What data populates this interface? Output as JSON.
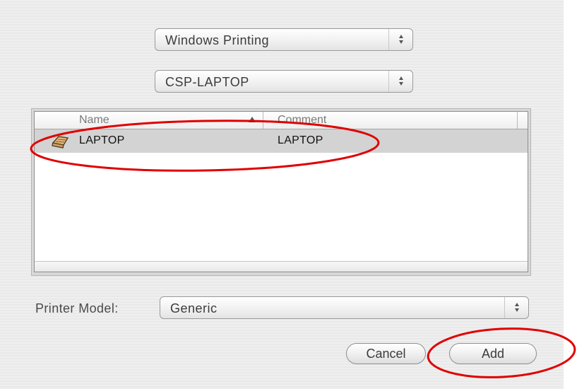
{
  "protocol_popup": {
    "value": "Windows Printing"
  },
  "host_popup": {
    "value": "CSP-LAPTOP"
  },
  "printer_table": {
    "columns": [
      "Name",
      "Comment"
    ],
    "rows": [
      {
        "name": "LAPTOP",
        "comment": "LAPTOP",
        "selected": true,
        "icon": "printer-icon"
      }
    ]
  },
  "printer_model": {
    "label": "Printer Model:",
    "value": "Generic"
  },
  "buttons": {
    "cancel": "Cancel",
    "add": "Add"
  },
  "annotation_color": "#e00000"
}
